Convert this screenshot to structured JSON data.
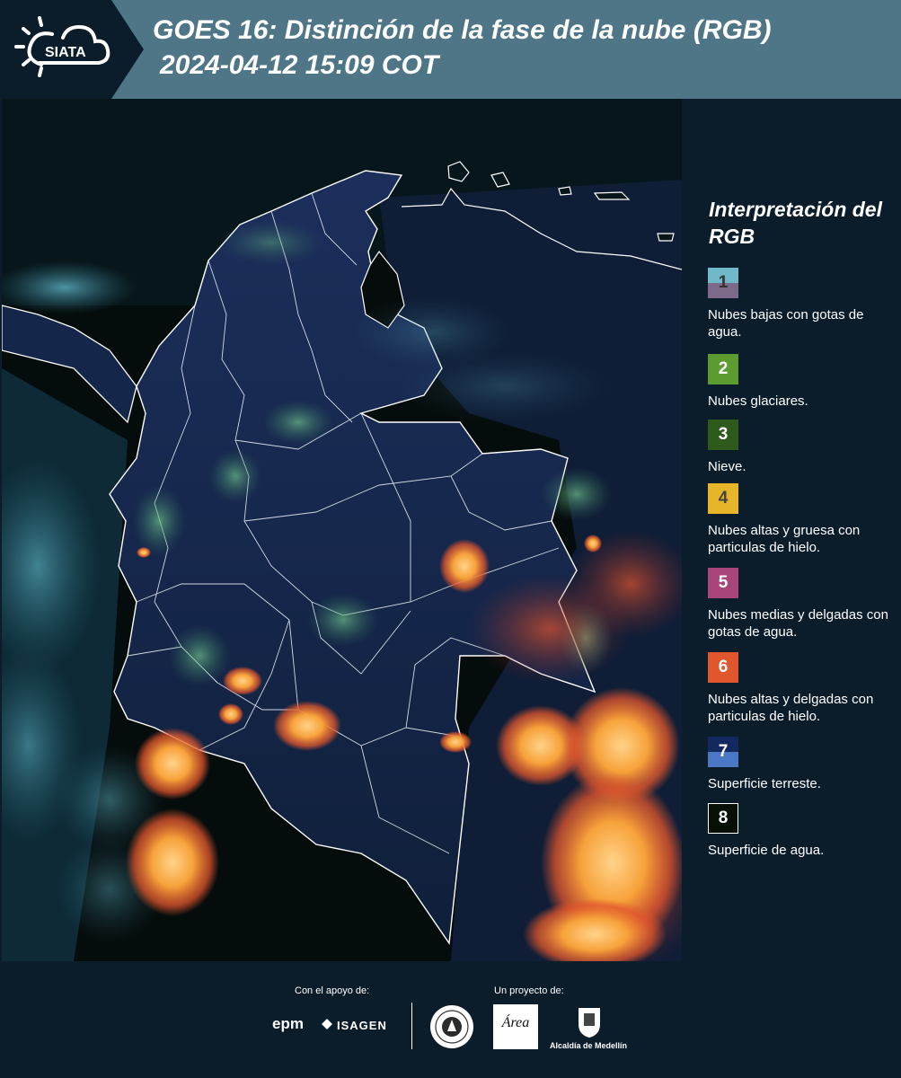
{
  "header": {
    "logo_text": "SIATA",
    "title_line1": "GOES 16: Distinción de la fase de la nube (RGB)",
    "title_line2": "2024-04-12 15:09 COT"
  },
  "legend": {
    "title": "Interpretación del RGB",
    "items": [
      {
        "num": "1",
        "label": "Nubes bajas con gotas de agua.",
        "color_top": "#6fb9c9",
        "color_bottom": "#7d6a8a",
        "num_color": "#333333"
      },
      {
        "num": "2",
        "label": "Nubes glaciares.",
        "color_top": "#5b9b2f",
        "num_color": "#ffffff"
      },
      {
        "num": "3",
        "label": "Nieve.",
        "color_top": "#2e5a1c",
        "num_color": "#ffffff"
      },
      {
        "num": "4",
        "label": "Nubes altas y gruesa con particulas de hielo.",
        "color_top": "#e6b52a",
        "num_color": "#444444"
      },
      {
        "num": "5",
        "label": "Nubes medias y delgadas con gotas de agua.",
        "color_top": "#a8467a",
        "num_color": "#ffffff"
      },
      {
        "num": "6",
        "label": "Nubes altas y delgadas con particulas de hielo.",
        "color_top": "#e2562d",
        "num_color": "#ffffff"
      },
      {
        "num": "7",
        "label": "Superficie terreste.",
        "color_top": "#13285e",
        "color_bottom": "#4a78c4",
        "num_color": "#ffffff"
      },
      {
        "num": "8",
        "label": "Superficie de agua.",
        "color_top": "#061006",
        "num_color": "#ffffff",
        "border": "#ffffff"
      }
    ]
  },
  "footer": {
    "support_label": "Con el apoyo de:",
    "project_label": "Un proyecto de:",
    "sponsor_1": "epm",
    "sponsor_2": "ISAGEN",
    "area_logo_text": "Área",
    "municipality": "Alcaldía de Medellín"
  }
}
